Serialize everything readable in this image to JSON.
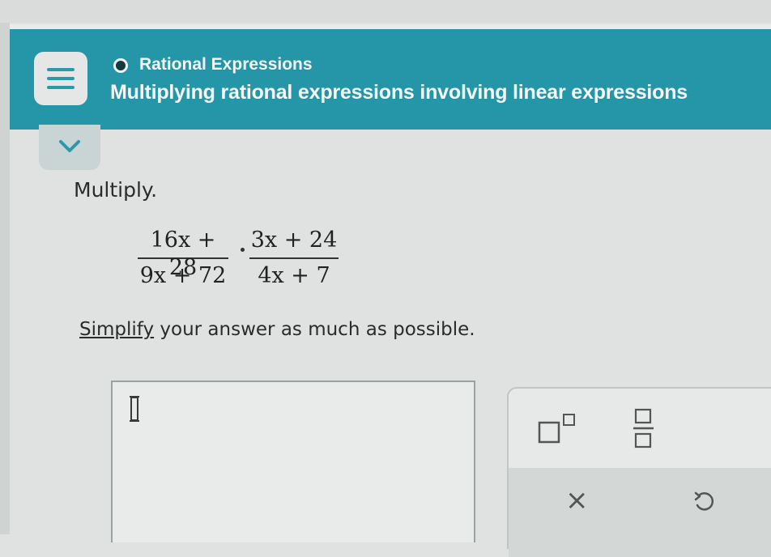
{
  "header": {
    "topic": "Rational Expressions",
    "title": "Multiplying rational expressions involving linear expressions"
  },
  "problem": {
    "instruction": "Multiply.",
    "fraction1": {
      "numerator": "16x + 28",
      "denominator": "9x + 72"
    },
    "operator": "·",
    "fraction2": {
      "numerator": "3x + 24",
      "denominator": "4x + 7"
    },
    "simplify_link": "Simplify",
    "simplify_rest": " your answer as much as possible."
  },
  "keypad": {
    "keys": [
      "superscript-icon",
      "fraction-icon",
      "clear-icon",
      "undo-icon"
    ],
    "clear_label": "×"
  },
  "colors": {
    "header": "#2596a8",
    "text": "#2b2b2b"
  }
}
